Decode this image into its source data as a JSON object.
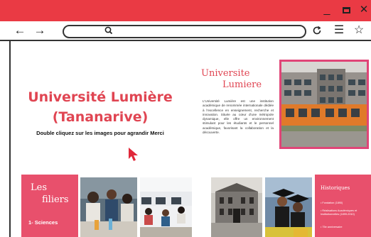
{
  "browser": {
    "url_value": "",
    "icons": {
      "back": "arrow-left-icon",
      "forward": "arrow-right-icon",
      "search": "search-icon",
      "reload": "reload-icon",
      "menu": "hamburger-menu-icon",
      "bookmark": "star-icon",
      "minimize": "minimize-icon",
      "maximize": "maximize-icon",
      "close": "close-icon"
    },
    "accent_color": "#ea3a44"
  },
  "hero": {
    "title_line1": "Université Lumière",
    "title_line2": "(Tananarive)",
    "subtitle": "Double cliquez sur les images pour agrandir Merci"
  },
  "about": {
    "heading_line1": "Universite",
    "heading_line2": "Lumiere",
    "description": "L'Université Lumière est une institution académique de renommée internationale dédiée à l'excellence en enseignement, recherche et innovation. Située au cœur d'une métropole dynamique, elle offre un environnement stimulant pour les étudiants et le personnel académique, favorisant la collaboration et la découverte."
  },
  "filiers": {
    "title_line1": "Les",
    "title_line2": "filiers",
    "items": [
      "1- Sciences"
    ]
  },
  "historiques": {
    "title": "Historiques",
    "events": [
      "• Fondation (1890)",
      "• Réalisations Académiques et Institutionnelles (1899-2010)",
      "• 75e anniversaire"
    ]
  },
  "colors": {
    "title_red": "#e04552",
    "panel_pink": "#e8506c",
    "frame_pink": "#e04577"
  }
}
